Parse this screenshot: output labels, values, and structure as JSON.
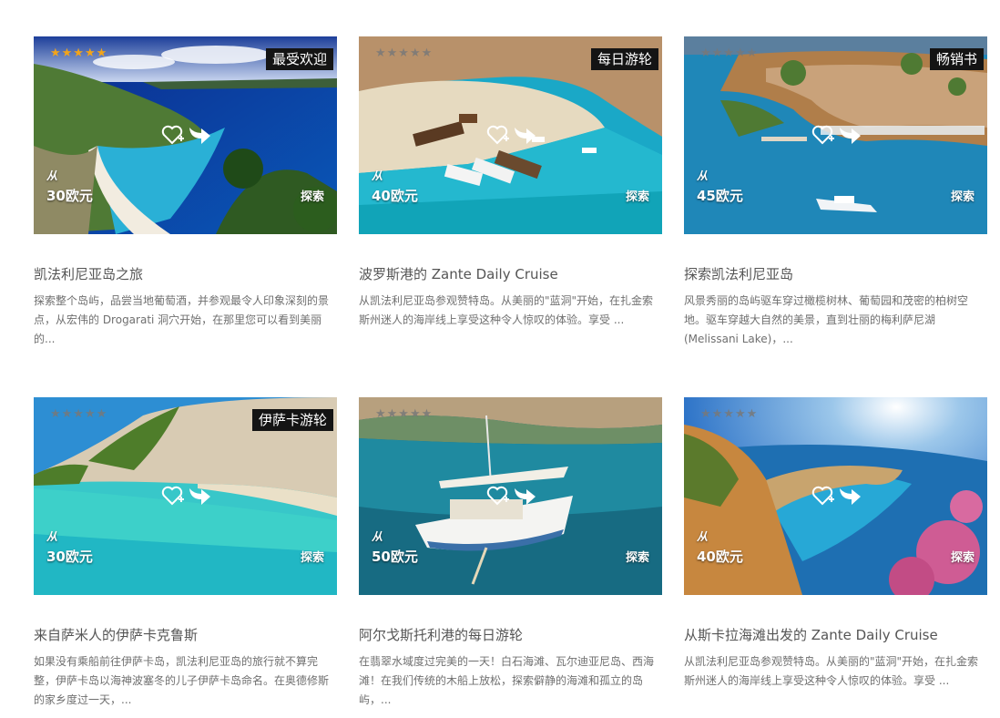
{
  "cards": [
    {
      "badge": "最受欢迎",
      "rating": 5,
      "from_label": "从",
      "price": "30欧元",
      "explore_label": "探索",
      "title": "凯法利尼亚岛之旅",
      "description": "探索整个岛屿，品尝当地葡萄酒，并参观最令人印象深刻的景点，从宏伟的 Drogarati 洞穴开始，在那里您可以看到美丽的..."
    },
    {
      "badge": "每日游轮",
      "rating": 0,
      "from_label": "从",
      "price": "40欧元",
      "explore_label": "探索",
      "title": "波罗斯港的 Zante Daily Cruise",
      "description": "从凯法利尼亚岛参观赞特岛。从美丽的\"蓝洞\"开始，在扎金索斯州迷人的海岸线上享受这种令人惊叹的体验。享受 ..."
    },
    {
      "badge": "畅销书",
      "rating": 0,
      "from_label": "从",
      "price": "45欧元",
      "explore_label": "探索",
      "title": "探索凯法利尼亚岛",
      "description": "风景秀丽的岛屿驱车穿过橄榄树林、葡萄园和茂密的柏树空地。驱车穿越大自然的美景，直到壮丽的梅利萨尼湖 (Melissani Lake)，..."
    },
    {
      "badge": "伊萨卡游轮",
      "rating": 0,
      "from_label": "从",
      "price": "30欧元",
      "explore_label": "探索",
      "title": "来自萨米人的伊萨卡克鲁斯",
      "description": "如果没有乘船前往伊萨卡岛，凯法利尼亚岛的旅行就不算完整，伊萨卡岛以海神波塞冬的儿子伊萨卡岛命名。在奥德修斯的家乡度过一天，..."
    },
    {
      "badge": "",
      "rating": 0,
      "from_label": "从",
      "price": "50欧元",
      "explore_label": "探索",
      "title": "阿尔戈斯托利港的每日游轮",
      "description": "在翡翠水域度过完美的一天！白石海滩、瓦尔迪亚尼岛、西海滩！在我们传统的木船上放松，探索僻静的海滩和孤立的岛屿，..."
    },
    {
      "badge": "",
      "rating": 0,
      "from_label": "从",
      "price": "40欧元",
      "explore_label": "探索",
      "title": "从斯卡拉海滩出发的 Zante Daily Cruise",
      "description": "从凯法利尼亚岛参观赞特岛。从美丽的\"蓝洞\"开始，在扎金索斯州迷人的海岸线上享受这种令人惊叹的体验。享受 ..."
    }
  ]
}
